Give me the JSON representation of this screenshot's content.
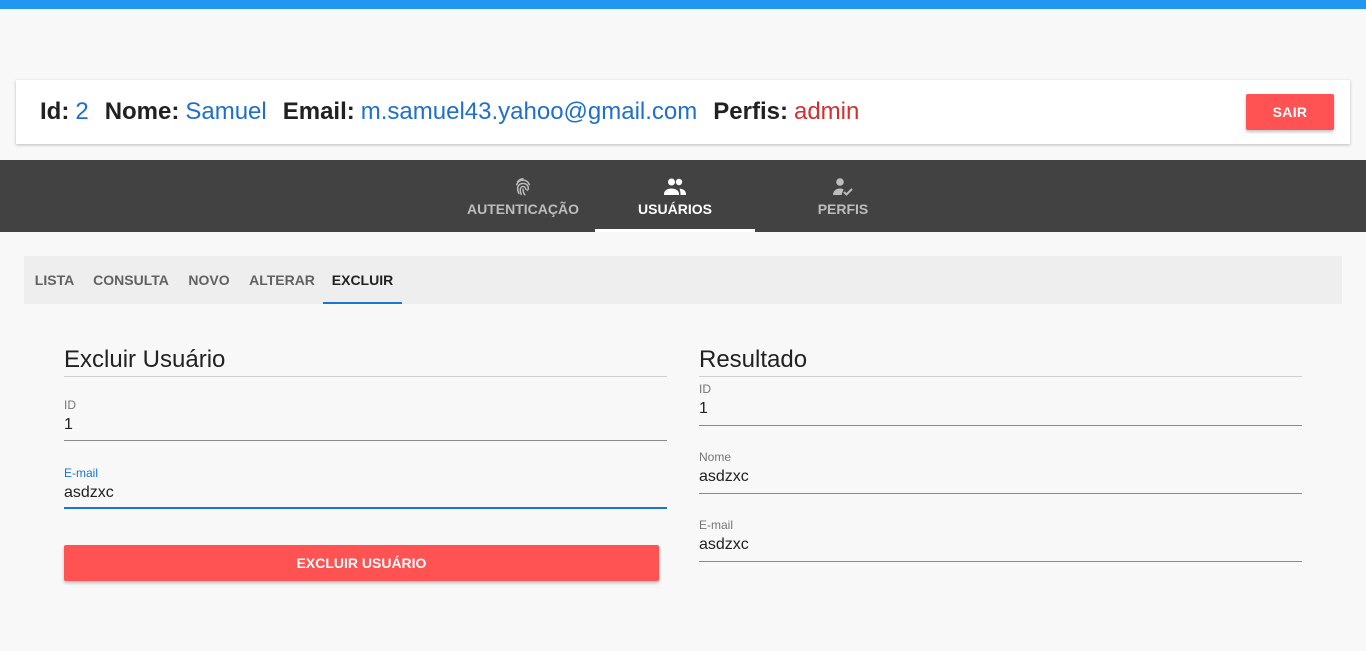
{
  "colors": {
    "accent": "#2196f3",
    "danger": "#ff5252",
    "link": "#1e6fd0",
    "admin": "#d32f2f",
    "nav_bg": "#424242"
  },
  "user": {
    "id_label": "Id:",
    "id_value": "2",
    "name_label": "Nome:",
    "name_value": "Samuel",
    "email_label": "Email:",
    "email_value": "m.samuel43.yahoo@gmail.com",
    "profile_label": "Perfis:",
    "profile_value": "admin",
    "logout_label": "SAIR"
  },
  "nav": {
    "tabs": [
      {
        "label": "AUTENTICAÇÃO",
        "icon": "fingerprint-icon"
      },
      {
        "label": "USUÁRIOS",
        "icon": "people-icon",
        "active": true
      },
      {
        "label": "PERFIS",
        "icon": "person-check-icon"
      }
    ]
  },
  "subtabs": [
    "LISTA",
    "CONSULTA",
    "NOVO",
    "ALTERAR",
    "EXCLUIR"
  ],
  "active_subtab": "EXCLUIR",
  "form": {
    "title": "Excluir Usuário",
    "id_label": "ID",
    "id_value": "1",
    "email_label": "E-mail",
    "email_value": "asdzxc",
    "submit_label": "EXCLUIR USUÁRIO"
  },
  "result": {
    "title": "Resultado",
    "id_label": "ID",
    "id_value": "1",
    "name_label": "Nome",
    "name_value": "asdzxc",
    "email_label": "E-mail",
    "email_value": "asdzxc"
  }
}
